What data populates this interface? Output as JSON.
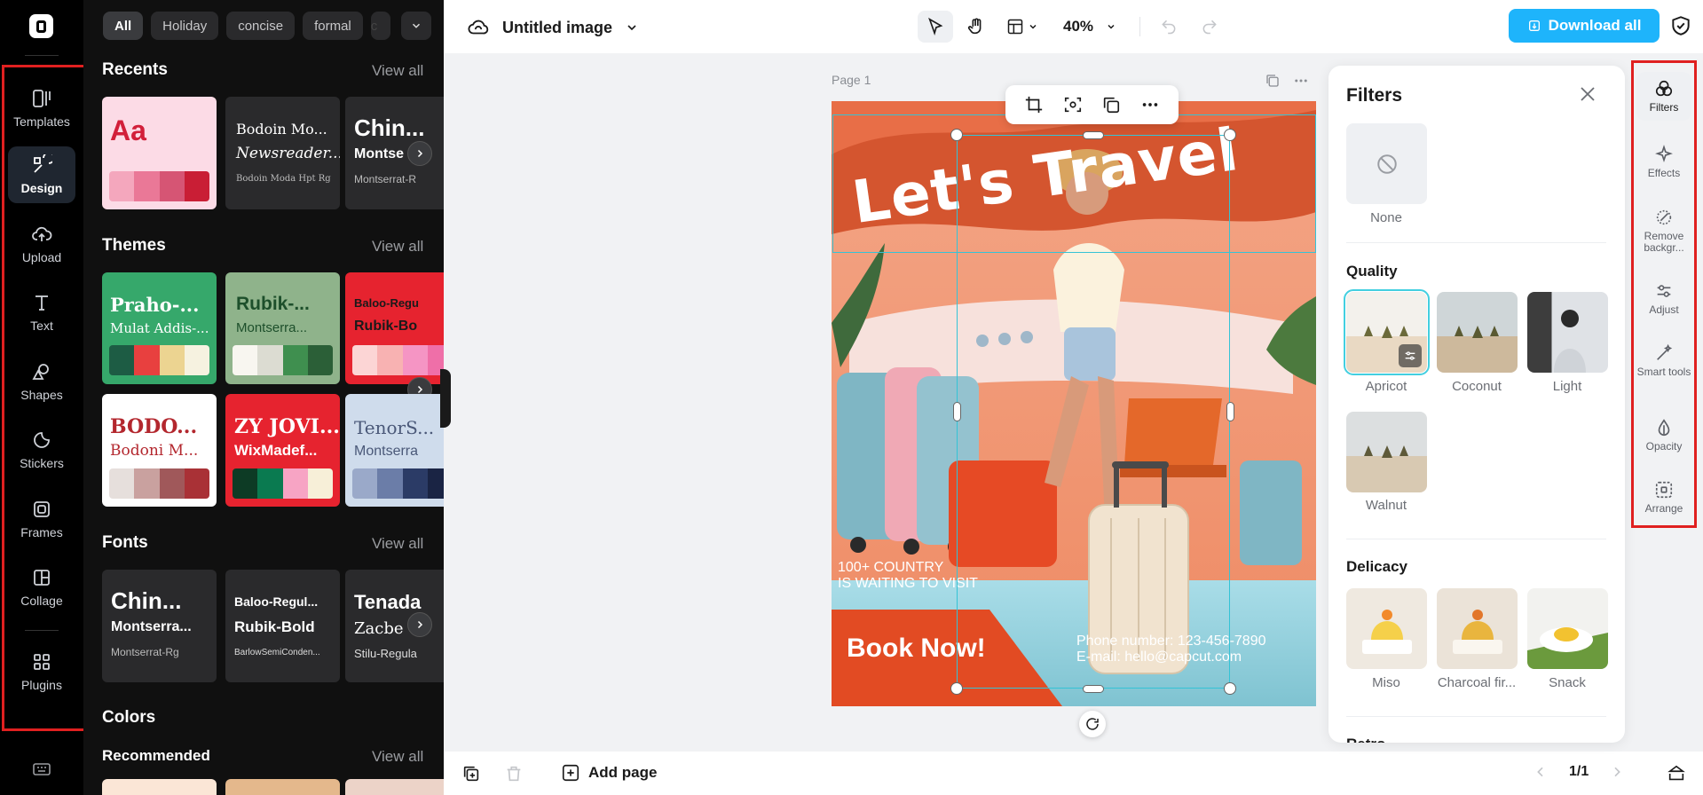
{
  "rail": {
    "items": [
      {
        "label": "Templates"
      },
      {
        "label": "Design"
      },
      {
        "label": "Upload"
      },
      {
        "label": "Text"
      },
      {
        "label": "Shapes"
      },
      {
        "label": "Stickers"
      },
      {
        "label": "Frames"
      },
      {
        "label": "Collage"
      },
      {
        "label": "Plugins"
      }
    ]
  },
  "panel": {
    "chips": [
      "All",
      "Holiday",
      "concise",
      "formal",
      "c"
    ],
    "recents": {
      "title": "Recents",
      "view_all": "View all",
      "card1": "Aa",
      "card2": {
        "l1": "Bodoin Mo...",
        "l2": "Newsreader...",
        "l3": "Bodoin Moda Hpt Rg"
      },
      "card3": {
        "l1": "Chin...",
        "l2": "Montse",
        "l3": "Montserrat-R"
      }
    },
    "themes": {
      "title": "Themes",
      "view_all": "View all",
      "cards": [
        {
          "l1": "Praho-...",
          "l2": "Mulat Addis-...",
          "colors": [
            "#1d5c44",
            "#e8403f",
            "#ecd491",
            "#f6f2e0"
          ]
        },
        {
          "l1": "Rubik-...",
          "l2": "Montserra...",
          "colors": [
            "#f8f6f0",
            "#dcdcd2",
            "#3f8f4f",
            "#2b5f37"
          ]
        },
        {
          "l1": "Baloo-Regu",
          "l2": "Rubik-Bo",
          "colors": [
            "#fcd5d5",
            "#f8b2b2",
            "#f595c4",
            "#ef6fa8"
          ]
        },
        {
          "l1": "BODO...",
          "l2": "Bodoni M...",
          "colors": [
            "#e6dfdc",
            "#c9a19f",
            "#a0585a",
            "#a93136"
          ]
        },
        {
          "l1": "ZY JOVI...",
          "l2": "WixMadef...",
          "colors": [
            "#0d3b25",
            "#0a7a50",
            "#f7a4c4",
            "#f7efd8"
          ]
        },
        {
          "l1": "TenorS...",
          "l2": "Montserra",
          "colors": [
            "#9aa9c9",
            "#6b7da8",
            "#2b3b66",
            "#1a2444"
          ]
        }
      ]
    },
    "fonts": {
      "title": "Fonts",
      "view_all": "View all",
      "cards": [
        {
          "l1": "Chin...",
          "l2": "Montserra...",
          "l3": "Montserrat-Rg"
        },
        {
          "l1": "Baloo-Regul...",
          "l2": "Rubik-Bold",
          "l3": "BarlowSemiConden..."
        },
        {
          "l1": "Tenada",
          "l2": "Zacbe",
          "l3": "Stilu-Regula"
        }
      ]
    },
    "colors": {
      "title": "Colors",
      "recommended": "Recommended",
      "view_all": "View all"
    }
  },
  "topbar": {
    "title": "Untitled image",
    "zoom": "40%",
    "download": "Download all"
  },
  "canvas": {
    "page_label": "Page 1",
    "poster": {
      "headline": "Let's Travel",
      "country": "100+ COUNTRY",
      "waiting": "IS WAITING TO VISIT",
      "book": "Book Now!",
      "phone": "Phone number: 123-456-7890",
      "email": "E-mail: hello@capcut.com"
    }
  },
  "bottombar": {
    "add_page": "Add page",
    "pages": "1/1"
  },
  "filters": {
    "title": "Filters",
    "none_label": "None",
    "quality_title": "Quality",
    "quality": [
      "Apricot",
      "Coconut",
      "Light",
      "Walnut"
    ],
    "delicacy_title": "Delicacy",
    "delicacy": [
      "Miso",
      "Charcoal fir...",
      "Snack"
    ],
    "retro_title": "Retro"
  },
  "right_rail": {
    "items": [
      {
        "label": "Filters"
      },
      {
        "label": "Effects"
      },
      {
        "label": "Remove backgr..."
      },
      {
        "label": "Adjust"
      },
      {
        "label": "Smart tools"
      },
      {
        "label": "Opacity"
      },
      {
        "label": "Arrange"
      }
    ]
  },
  "colors": {
    "accent": "#1eb4fb",
    "highlight": "#e02020",
    "selection": "#34c3d6"
  }
}
